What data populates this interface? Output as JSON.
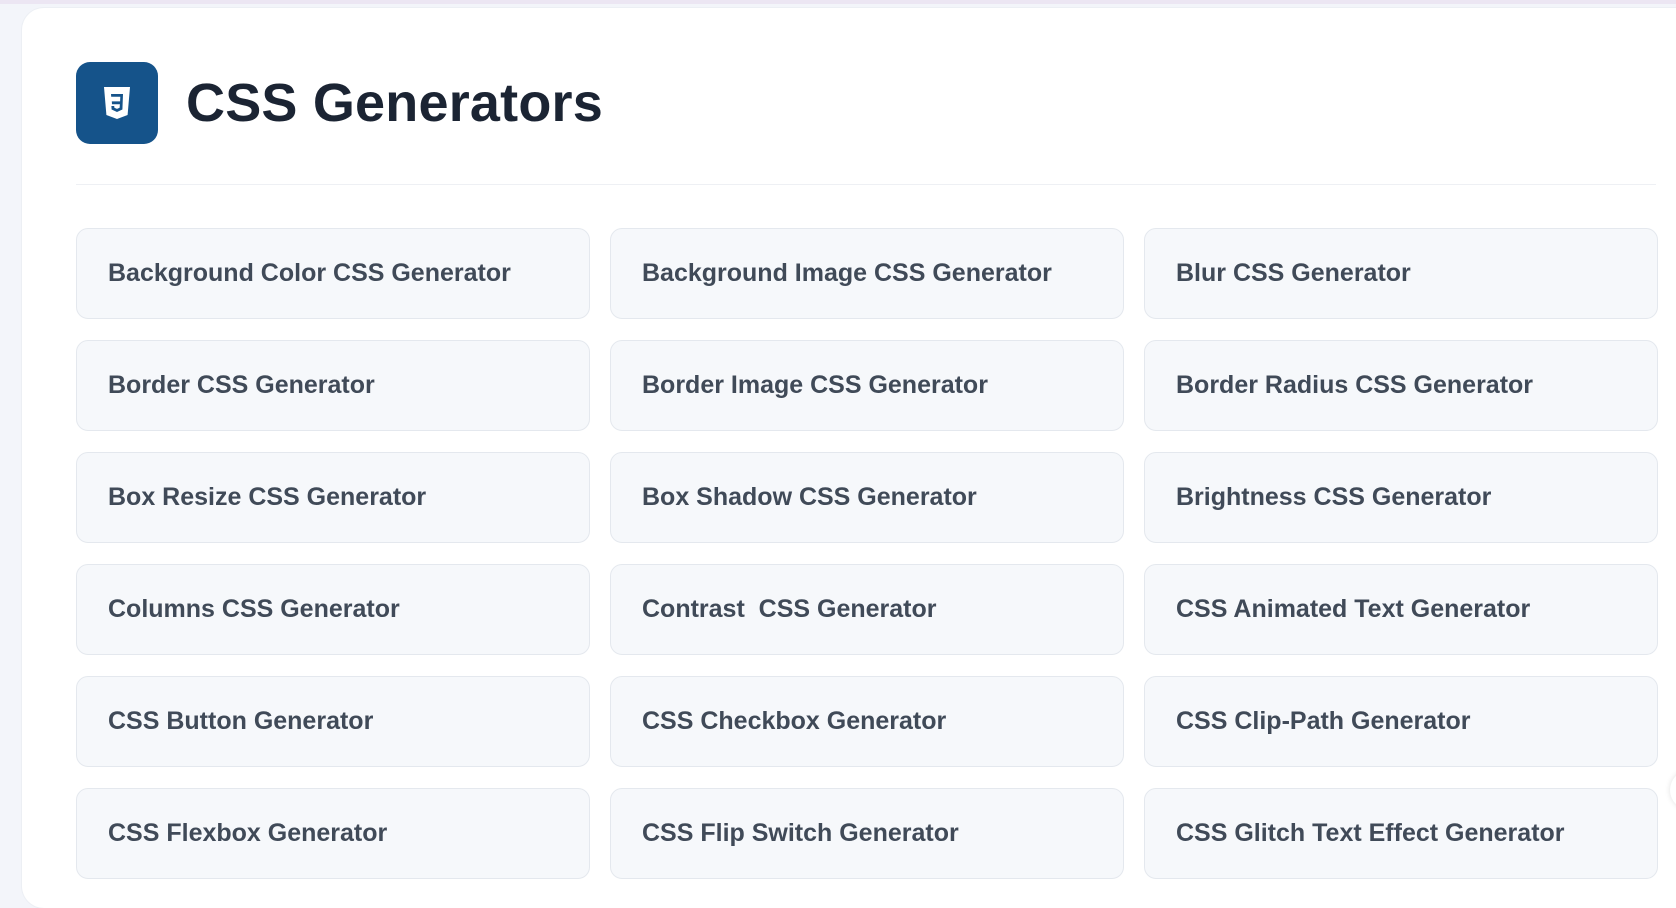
{
  "page": {
    "title": "CSS Generators",
    "logo_icon": "css3-icon"
  },
  "colors": {
    "logo_bg": "#15538a",
    "title_text": "#1b2433",
    "card_bg": "#f6f8fb",
    "card_border": "#e4e8ee",
    "card_text": "#404a58"
  },
  "generators": [
    {
      "label": "Background Color CSS Generator"
    },
    {
      "label": "Background Image CSS Generator"
    },
    {
      "label": "Blur CSS Generator"
    },
    {
      "label": "Border CSS Generator"
    },
    {
      "label": "Border Image CSS Generator"
    },
    {
      "label": "Border Radius CSS Generator"
    },
    {
      "label": "Box Resize CSS Generator"
    },
    {
      "label": "Box Shadow CSS Generator"
    },
    {
      "label": "Brightness CSS Generator"
    },
    {
      "label": "Columns CSS Generator"
    },
    {
      "label": "Contrast  CSS Generator"
    },
    {
      "label": "CSS Animated Text Generator"
    },
    {
      "label": "CSS Button Generator"
    },
    {
      "label": "CSS Checkbox Generator"
    },
    {
      "label": "CSS Clip-Path Generator"
    },
    {
      "label": "CSS Flexbox Generator"
    },
    {
      "label": "CSS Flip Switch Generator"
    },
    {
      "label": "CSS Glitch Text Effect Generator"
    }
  ]
}
